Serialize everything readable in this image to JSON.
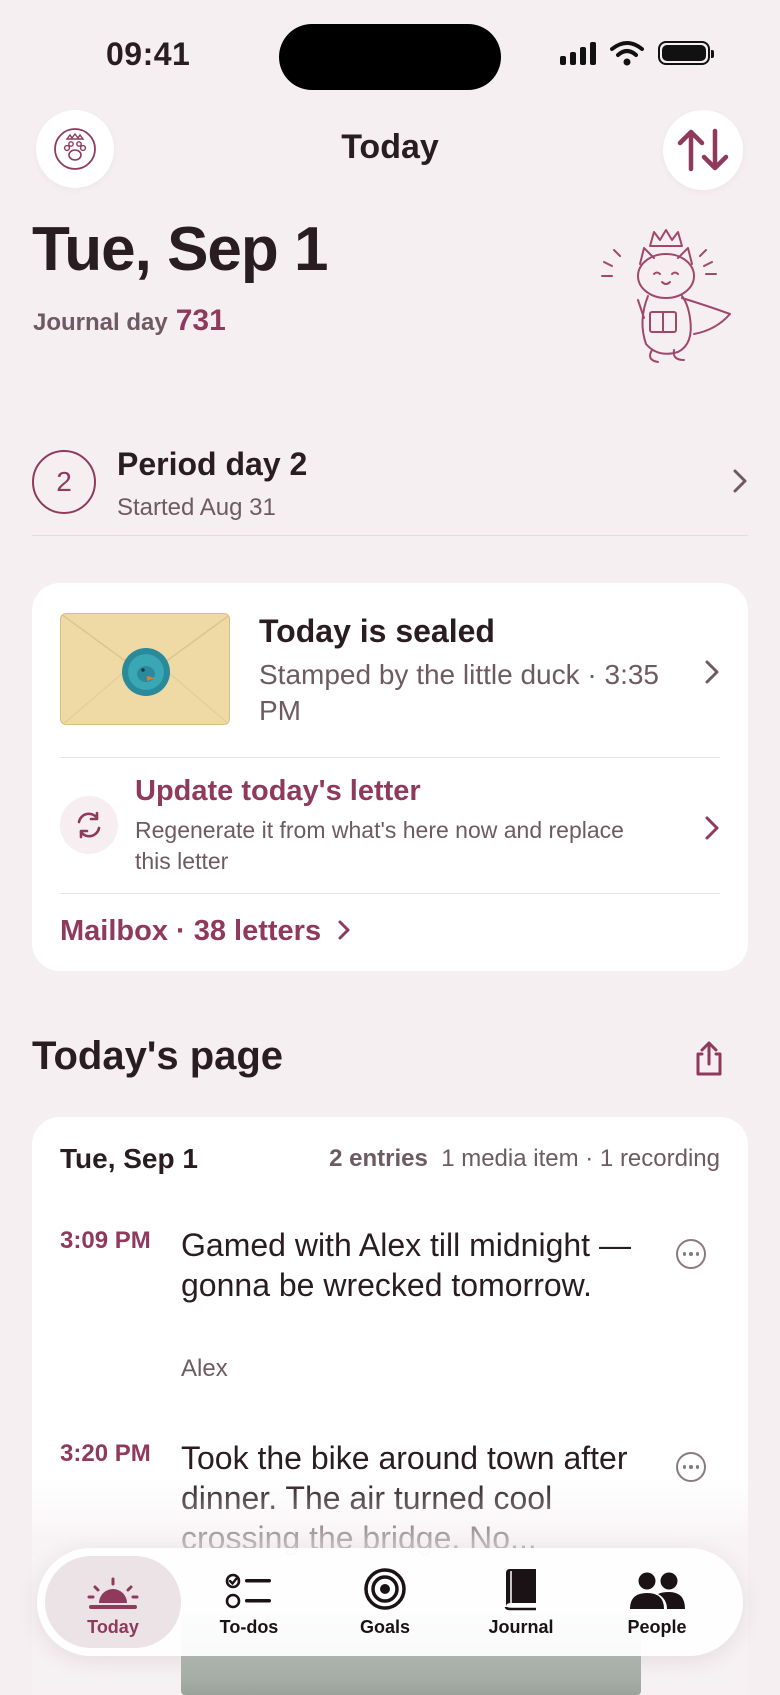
{
  "status_bar": {
    "time": "09:41"
  },
  "header": {
    "title": "Today"
  },
  "hero": {
    "date": "Tue, Sep 1",
    "journal_day_label": "Journal day",
    "journal_day_number": "731"
  },
  "period": {
    "day_number": "2",
    "title": "Period day 2",
    "subtitle": "Started Aug 31"
  },
  "sealed": {
    "title": "Today is sealed",
    "subtitle": "Stamped by the little duck · 3:35 PM",
    "update_title": "Update today's letter",
    "update_subtitle": "Regenerate it from what's here now and replace this letter",
    "mailbox_label": "Mailbox · 38 letters"
  },
  "todays_page": {
    "title": "Today's page",
    "date": "Tue, Sep 1",
    "entries_count": "2 entries",
    "media_summary": "1 media item · 1 recording",
    "entries": [
      {
        "time": "3:09 PM",
        "text": "Gamed with Alex till midnight — gonna be wrecked tomorrow.",
        "tag": "Alex"
      },
      {
        "time": "3:20 PM",
        "text": "Took the bike around town after dinner. The air turned cool crossing the bridge. No..."
      }
    ]
  },
  "tabbar": {
    "tabs": [
      {
        "label": "Today",
        "icon": "sunrise-icon",
        "active": true
      },
      {
        "label": "To-dos",
        "icon": "checklist-icon"
      },
      {
        "label": "Goals",
        "icon": "target-icon"
      },
      {
        "label": "Journal",
        "icon": "book-icon"
      },
      {
        "label": "People",
        "icon": "people-icon"
      }
    ]
  },
  "colors": {
    "accent": "#8f3a5c",
    "background": "#f5eff1",
    "card": "#ffffff",
    "text": "#2a1d22",
    "muted": "#6e5a62"
  }
}
